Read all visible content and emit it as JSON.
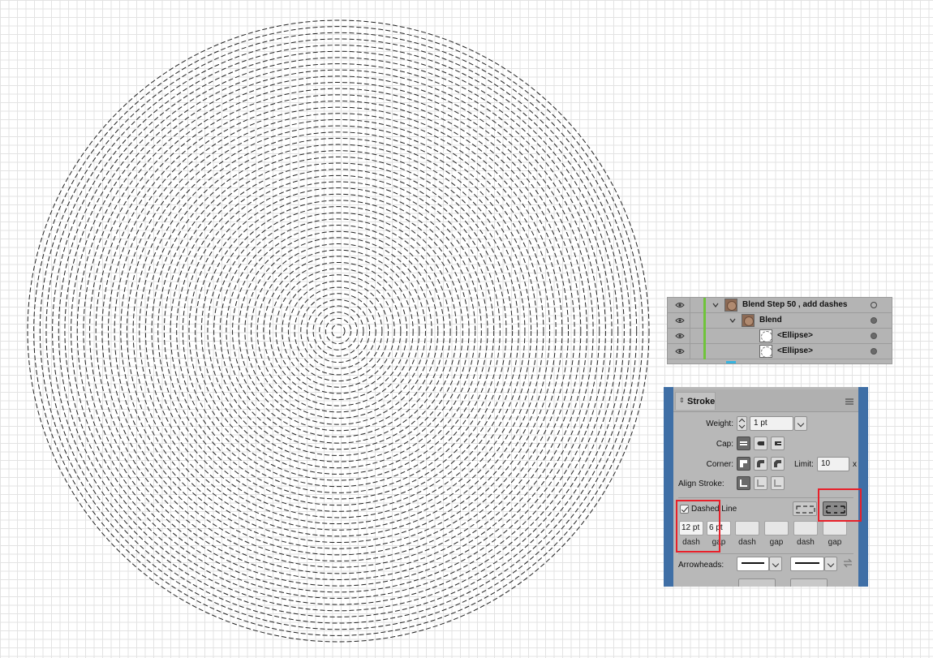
{
  "canvas": {
    "background": "#ffffff",
    "grid_color": "#e3e3e3",
    "stroke_color": "#222222",
    "dash": 6,
    "gap": 3,
    "ring_count": 50
  },
  "layers": {
    "rows": [
      {
        "name": "Blend Step 50 , add dashes",
        "indent": 0,
        "expanded": true,
        "thumb": "blend",
        "target": "hollow"
      },
      {
        "name": "Blend",
        "indent": 1,
        "expanded": true,
        "thumb": "blend",
        "target": "filled"
      },
      {
        "name": "<Ellipse>",
        "indent": 2,
        "expanded": false,
        "thumb": "ellipse",
        "target": "filled"
      },
      {
        "name": "<Ellipse>",
        "indent": 2,
        "expanded": false,
        "thumb": "ellipse",
        "target": "filled"
      }
    ],
    "icons": {
      "visibility": "eye-icon",
      "expand": "chevron-down-icon",
      "target": "target-circle-icon"
    }
  },
  "stroke": {
    "tab_label": "Stroke",
    "weight_label": "Weight:",
    "weight_value": "1 pt",
    "cap_label": "Cap:",
    "corner_label": "Corner:",
    "limit_label": "Limit:",
    "limit_value": "10",
    "limit_unit": "x",
    "align_label": "Align Stroke:",
    "dashed_line_label": "Dashed Line",
    "dashed_checked": true,
    "dashes": [
      {
        "value": "12 pt",
        "label": "dash"
      },
      {
        "value": "6 pt",
        "label": "gap"
      },
      {
        "value": "",
        "label": "dash"
      },
      {
        "value": "",
        "label": "gap"
      },
      {
        "value": "",
        "label": "dash"
      },
      {
        "value": "",
        "label": "gap"
      }
    ],
    "arrowheads_label": "Arrowheads:",
    "highlight_color": "#e8202a",
    "frame_color": "#3f6fa6"
  }
}
